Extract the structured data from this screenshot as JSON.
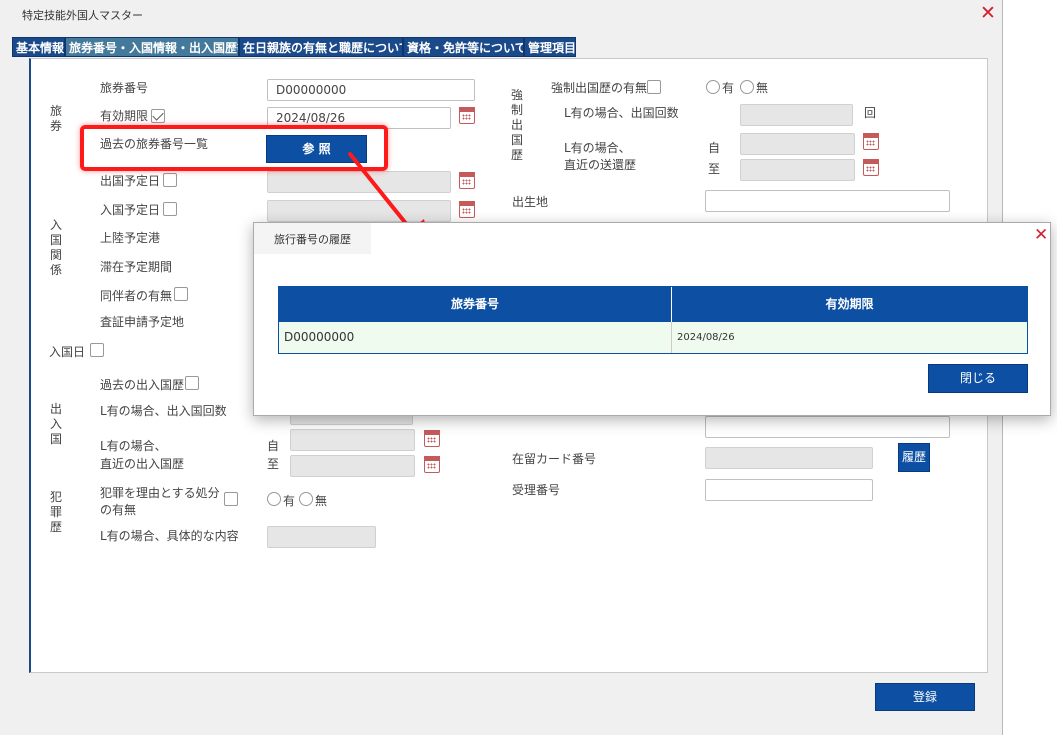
{
  "window": {
    "title": "特定技能外国人マスター",
    "tabs": [
      "基本情報",
      "旅券番号・入国情報・出入国歴等",
      "在日親族の有無と職歴について",
      "資格・免許等について",
      "管理項目"
    ]
  },
  "passport": {
    "section_label": "旅券",
    "number_label": "旅券番号",
    "number_value": "D00000000",
    "expiry_label": "有効期限",
    "expiry_value": "2024/08/26",
    "past_list_label": "過去の旅券番号一覧",
    "reference_button": "参 照"
  },
  "entry_relation": {
    "section_label": "入国関係",
    "departure_plan_label": "出国予定日",
    "entry_plan_label": "入国予定日",
    "landing_port_label": "上陸予定港",
    "stay_period_label": "滞在予定期間",
    "companion_label": "同伴者の有無",
    "visa_place_label": "査証申請予定地"
  },
  "entry_date_label": "入国日",
  "immigration": {
    "section_label": "出入国",
    "past_history_label": "過去の出入国歴",
    "count_label": "L有の場合、出入国回数",
    "recent_label_1": "L有の場合、",
    "recent_label_2": "直近の出入国歴",
    "from_label": "自",
    "to_label": "至"
  },
  "crime": {
    "section_label": "犯罪歴",
    "disposition_label_1": "犯罪を理由とする処分",
    "disposition_label_2": "の有無",
    "yes_label": "有",
    "no_label": "無",
    "detail_label": "L有の場合、具体的な内容"
  },
  "deportation": {
    "section_label": "強制出国歴",
    "has_label": "強制出国歴の有無",
    "yes_label": "有",
    "no_label": "無",
    "count_label": "L有の場合、出国回数",
    "count_unit": "回",
    "recent_label_1": "L有の場合、",
    "recent_label_2": "直近の送還歴",
    "from_label": "自",
    "to_label": "至"
  },
  "birthplace_label": "出生地",
  "residence_card_label": "在留カード番号",
  "history_button": "履歴",
  "receipt_label": "受理番号",
  "register_button": "登録",
  "popup": {
    "title": "旅行番号の履歴",
    "columns": [
      "旅券番号",
      "有効期限"
    ],
    "rows": [
      {
        "passport_no": "D00000000",
        "expiry": "2024/08/26"
      }
    ],
    "close_button": "閉じる"
  },
  "colors": {
    "primary": "#0d4fa3",
    "active_tab": "#43799a",
    "highlight": "#ff1a1a",
    "close": "#d31f2b",
    "calendar": "#c55a5a",
    "row_bg": "#effbef"
  }
}
